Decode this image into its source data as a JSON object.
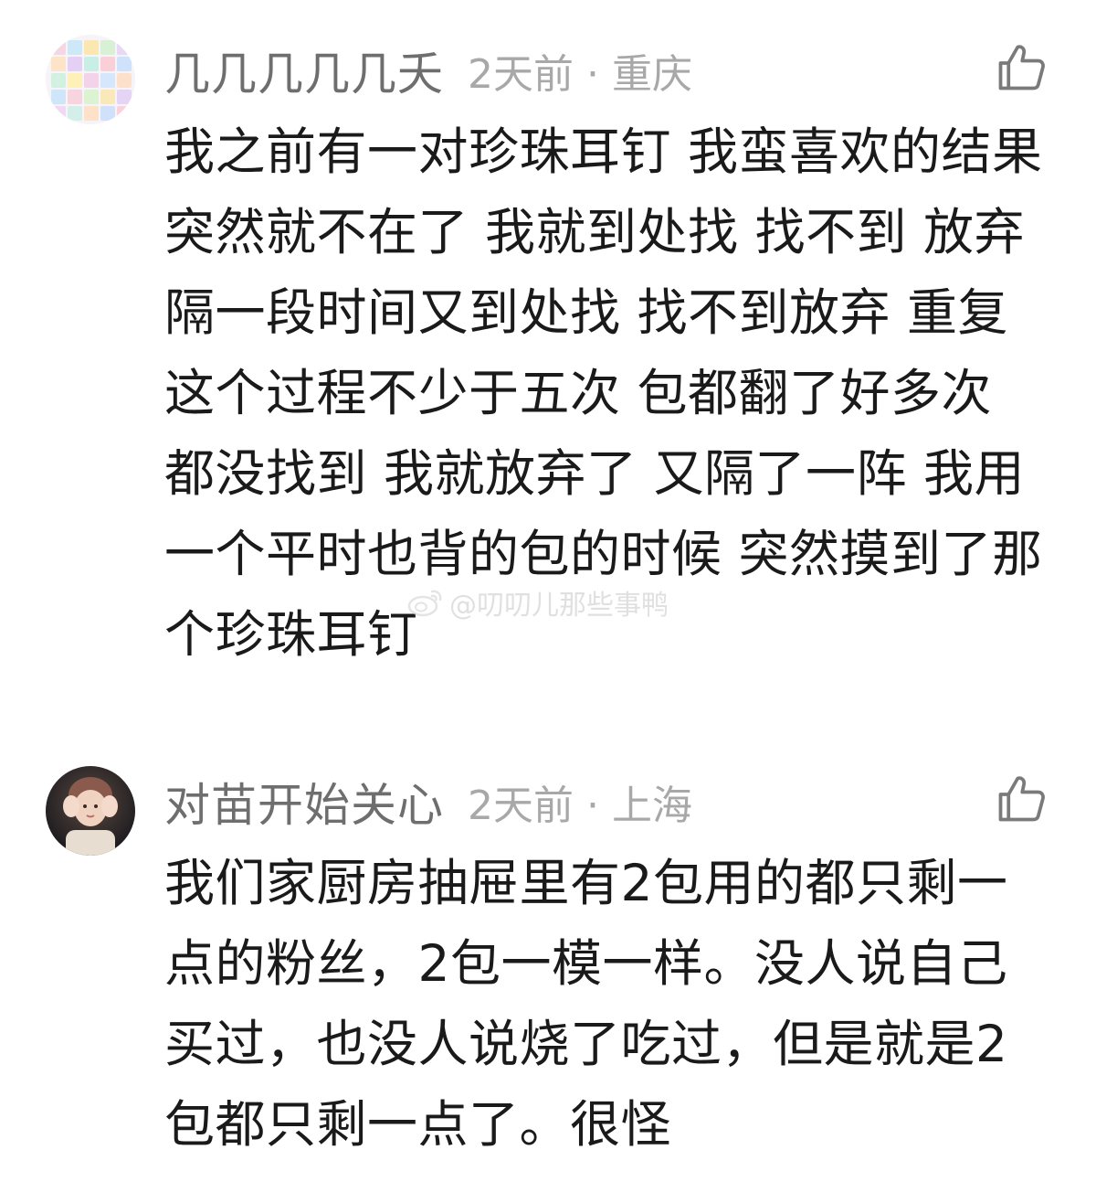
{
  "comments": [
    {
      "username": "几几几几几夭",
      "time": "2天前",
      "separator": "·",
      "location": "重庆",
      "avatar_icon": "pastel-color-grid-avatar",
      "like_icon": "thumbs-up-outline-icon",
      "text": "我之前有一对珍珠耳钉 我蛮喜欢的结果突然就不在了 我就到处找 找不到 放弃 隔一段时间又到处找 找不到放弃 重复这个过程不少于五次 包都翻了好多次 都没找到 我就放弃了 又隔了一阵 我用一个平时也背的包的时候 突然摸到了那个珍珠耳钉"
    },
    {
      "username": "对苗开始关心",
      "time": "2天前",
      "separator": "·",
      "location": "上海",
      "avatar_icon": "person-photo-avatar",
      "like_icon": "thumbs-up-outline-icon",
      "text": "我们家厨房抽屉里有2包用的都只剩一点的粉丝，2包一模一样。没人说自己买过，也没人说烧了吃过，但是就是2包都只剩一点了。很怪"
    }
  ],
  "watermark": {
    "text": "@叨叨儿那些事鸭",
    "icon": "weibo-logo-icon"
  },
  "colors": {
    "username": "#6e6e6e",
    "meta": "#a8a8a8",
    "body_text": "#1a1a1a",
    "like_icon": "#7a7a7a",
    "background": "#ffffff"
  }
}
